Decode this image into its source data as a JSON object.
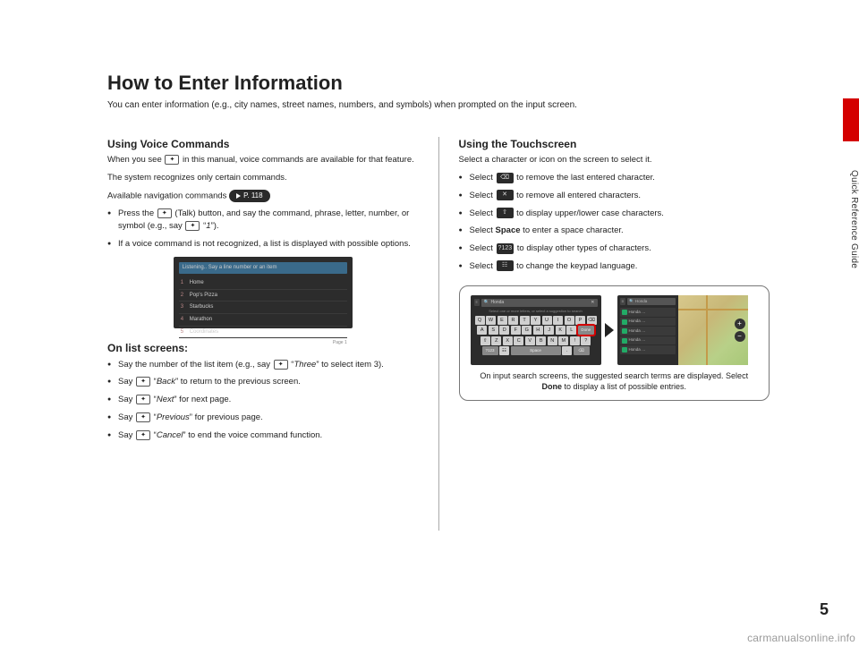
{
  "sideTab": "Quick Reference Guide",
  "title": "How to Enter Information",
  "intro": "You can enter information (e.g., city names, street names, numbers, and symbols) when prompted on the input screen.",
  "left": {
    "h1": "Using Voice Commands",
    "p1a": "When you see ",
    "p1b": " in this manual, voice commands are available for that feature.",
    "p2": "The system recognizes only certain commands.",
    "p3": "Available navigation commands ",
    "pill": "P. 118",
    "b1a": "Press the ",
    "b1b": " (Talk) button, and say the command, phrase, letter, number, or symbol (e.g., say ",
    "b1c": " “",
    "b1d": "1",
    "b1e": "”).",
    "b2": "If a voice command is not recognized, a list is displayed with possible options.",
    "listHeader": "Listening.. Say a line number or an item",
    "listItems": [
      "Home",
      "Pop's Pizza",
      "Starbucks",
      "Marathon",
      "Coordinates"
    ],
    "listFoot": "Page 1",
    "h2": "On list screens:",
    "c1a": "Say the number of the list item (e.g., say ",
    "c1b": " “",
    "c1c": "Three",
    "c1d": "” to select item 3).",
    "c2a": "Say ",
    "c2b": " “",
    "c2c": "Back",
    "c2d": "” to return to the previous screen.",
    "c3a": "Say ",
    "c3b": " “",
    "c3c": "Next",
    "c3d": "” for next page.",
    "c4a": "Say ",
    "c4b": " “",
    "c4c": "Previous",
    "c4d": "” for previous page.",
    "c5a": "Say ",
    "c5b": " “",
    "c5c": "Cancel",
    "c5d": "” to end the voice command function."
  },
  "right": {
    "h1": "Using the Touchscreen",
    "p1": "Select a character or icon on the screen to select it.",
    "b1a": "Select ",
    "b1b": " to remove the last entered character.",
    "b2a": "Select ",
    "b2b": " to remove all entered characters.",
    "b3a": "Select ",
    "b3b": " to display upper/lower case characters.",
    "b4a": "Select ",
    "b4b": "Space",
    "b4c": " to enter a space character.",
    "b5a": "Select ",
    "b5b": " to display other types of characters.",
    "b6a": "Select ",
    "b6b": " to change the keypad language.",
    "iconDel": "⌫",
    "iconX": "✕",
    "iconShift": "⇧",
    "icon123": "?123",
    "iconGlobe": "☷",
    "kbSearch": "Honda",
    "kbSearchX": "✕",
    "kbHint": "Select one or more letters, or select a suggestion to search",
    "kbRows": {
      "r1": [
        "Q",
        "W",
        "E",
        "R",
        "T",
        "Y",
        "U",
        "I",
        "O",
        "P"
      ],
      "r2": [
        "A",
        "S",
        "D",
        "F",
        "G",
        "H",
        "J",
        "K",
        "L"
      ],
      "r3": [
        "Z",
        "X",
        "C",
        "V",
        "B",
        "N",
        "M"
      ]
    },
    "kbDone": "Done",
    "kbSpace": "Space",
    "kb123": "?123",
    "kbBack": "⌫",
    "cap1": "On input search screens, the suggested search terms are displayed. Select ",
    "cap2": "Done",
    "cap3": " to display a list of possible entries."
  },
  "pageNum": "5",
  "watermark": "carmanualsonline.info"
}
